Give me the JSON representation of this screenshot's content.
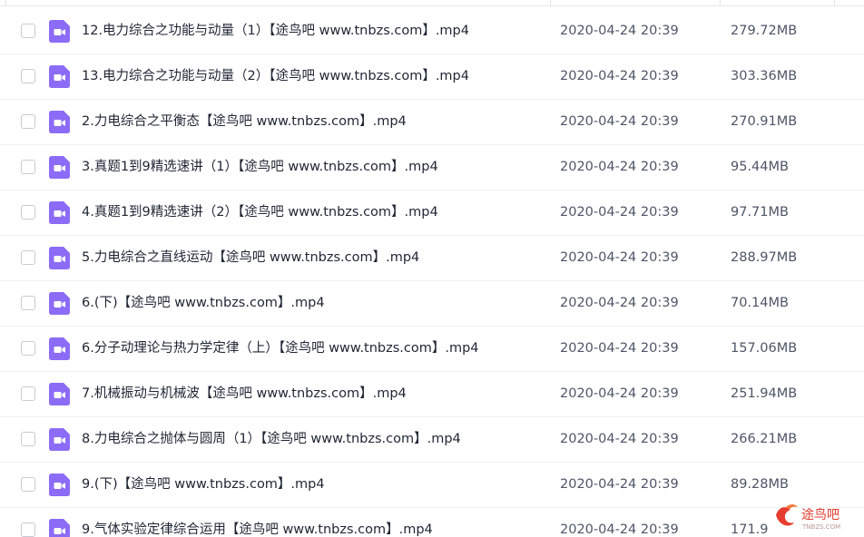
{
  "file_list": {
    "rows": [
      {
        "name": "12.电力综合之功能与动量（1）【途鸟吧 www.tnbzs.com】.mp4",
        "modified": "2020-04-24 20:39",
        "size": "279.72MB",
        "icon": "video-file-icon"
      },
      {
        "name": "13.电力综合之功能与动量（2）【途鸟吧 www.tnbzs.com】.mp4",
        "modified": "2020-04-24 20:39",
        "size": "303.36MB",
        "icon": "video-file-icon"
      },
      {
        "name": "2.力电综合之平衡态【途鸟吧 www.tnbzs.com】.mp4",
        "modified": "2020-04-24 20:39",
        "size": "270.91MB",
        "icon": "video-file-icon"
      },
      {
        "name": "3.真题1到9精选速讲（1）【途鸟吧 www.tnbzs.com】.mp4",
        "modified": "2020-04-24 20:39",
        "size": "95.44MB",
        "icon": "video-file-icon"
      },
      {
        "name": "4.真题1到9精选速讲（2）【途鸟吧 www.tnbzs.com】.mp4",
        "modified": "2020-04-24 20:39",
        "size": "97.71MB",
        "icon": "video-file-icon"
      },
      {
        "name": "5.力电综合之直线运动【途鸟吧 www.tnbzs.com】.mp4",
        "modified": "2020-04-24 20:39",
        "size": "288.97MB",
        "icon": "video-file-icon"
      },
      {
        "name": "6.(下)【途鸟吧 www.tnbzs.com】.mp4",
        "modified": "2020-04-24 20:39",
        "size": "70.14MB",
        "icon": "video-file-icon"
      },
      {
        "name": "6.分子动理论与热力学定律（上）【途鸟吧 www.tnbzs.com】.mp4",
        "modified": "2020-04-24 20:39",
        "size": "157.06MB",
        "icon": "video-file-icon"
      },
      {
        "name": "7.机械振动与机械波【途鸟吧 www.tnbzs.com】.mp4",
        "modified": "2020-04-24 20:39",
        "size": "251.94MB",
        "icon": "video-file-icon"
      },
      {
        "name": "8.力电综合之抛体与圆周（1）【途鸟吧 www.tnbzs.com】.mp4",
        "modified": "2020-04-24 20:39",
        "size": "266.21MB",
        "icon": "video-file-icon"
      },
      {
        "name": "9.(下)【途鸟吧 www.tnbzs.com】.mp4",
        "modified": "2020-04-24 20:39",
        "size": "89.28MB",
        "icon": "video-file-icon"
      },
      {
        "name": "9.气体实验定律综合运用【途鸟吧 www.tnbzs.com】.mp4",
        "modified": "2020-04-24 20:39",
        "size": "171.9",
        "icon": "video-file-icon"
      }
    ]
  },
  "watermark": {
    "text": "途鸟吧",
    "subtext": "TNBZS.COM",
    "icon": "bird-logo-icon"
  },
  "colors": {
    "icon": "#8c6cf6",
    "text": "#1f2533",
    "meta": "#4d5566",
    "watermark": "#e53d2f"
  }
}
